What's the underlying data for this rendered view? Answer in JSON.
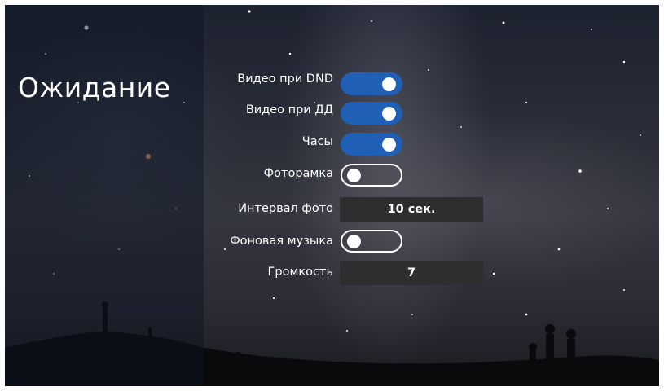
{
  "title": "Ожидание",
  "settings": [
    {
      "label": "Видео при DND",
      "control": "toggle",
      "state": "on"
    },
    {
      "label": "Видео при ДД",
      "control": "toggle",
      "state": "on"
    },
    {
      "label": "Часы",
      "control": "toggle",
      "state": "on"
    },
    {
      "label": "Фоторамка",
      "control": "toggle",
      "state": "off"
    },
    {
      "label": "Интервал фото",
      "control": "value",
      "value": "10 сек."
    },
    {
      "label": "Фоновая музыка",
      "control": "toggle",
      "state": "off"
    },
    {
      "label": "Громкость",
      "control": "value",
      "value": "7"
    }
  ],
  "colors": {
    "toggle_on": "#1f5fb5",
    "value_box": "#2e2e2e",
    "text": "#ffffff"
  }
}
